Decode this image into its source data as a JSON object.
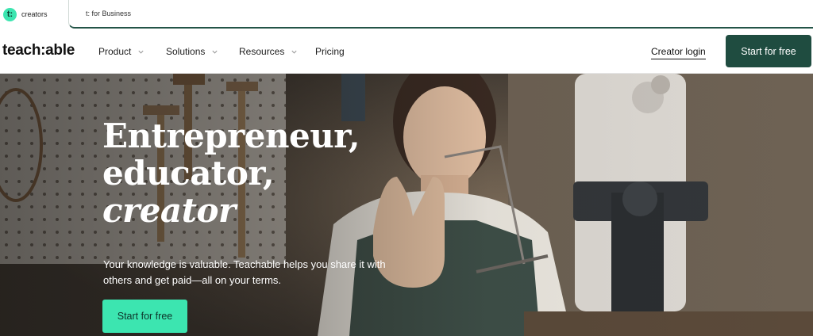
{
  "audience_tabs": {
    "creators_logo_letter": "t:",
    "creators_label": "creators",
    "business_label": "t: for Business"
  },
  "nav": {
    "brand": "teach:able",
    "items": [
      {
        "label": "Product",
        "has_dropdown": true
      },
      {
        "label": "Solutions",
        "has_dropdown": true
      },
      {
        "label": "Resources",
        "has_dropdown": true
      },
      {
        "label": "Pricing",
        "has_dropdown": false
      }
    ],
    "login_label": "Creator login",
    "cta_label": "Start for free"
  },
  "hero": {
    "headline_line1": "Entrepreneur,",
    "headline_line2": "educator,",
    "headline_line3": "creator",
    "subcopy": "Your knowledge is valuable. Teachable helps you share it with others and get paid—all on your terms.",
    "cta_label": "Start for free"
  },
  "colors": {
    "brand_dark_green": "#1f4c40",
    "brand_mint": "#3ce5b0"
  }
}
